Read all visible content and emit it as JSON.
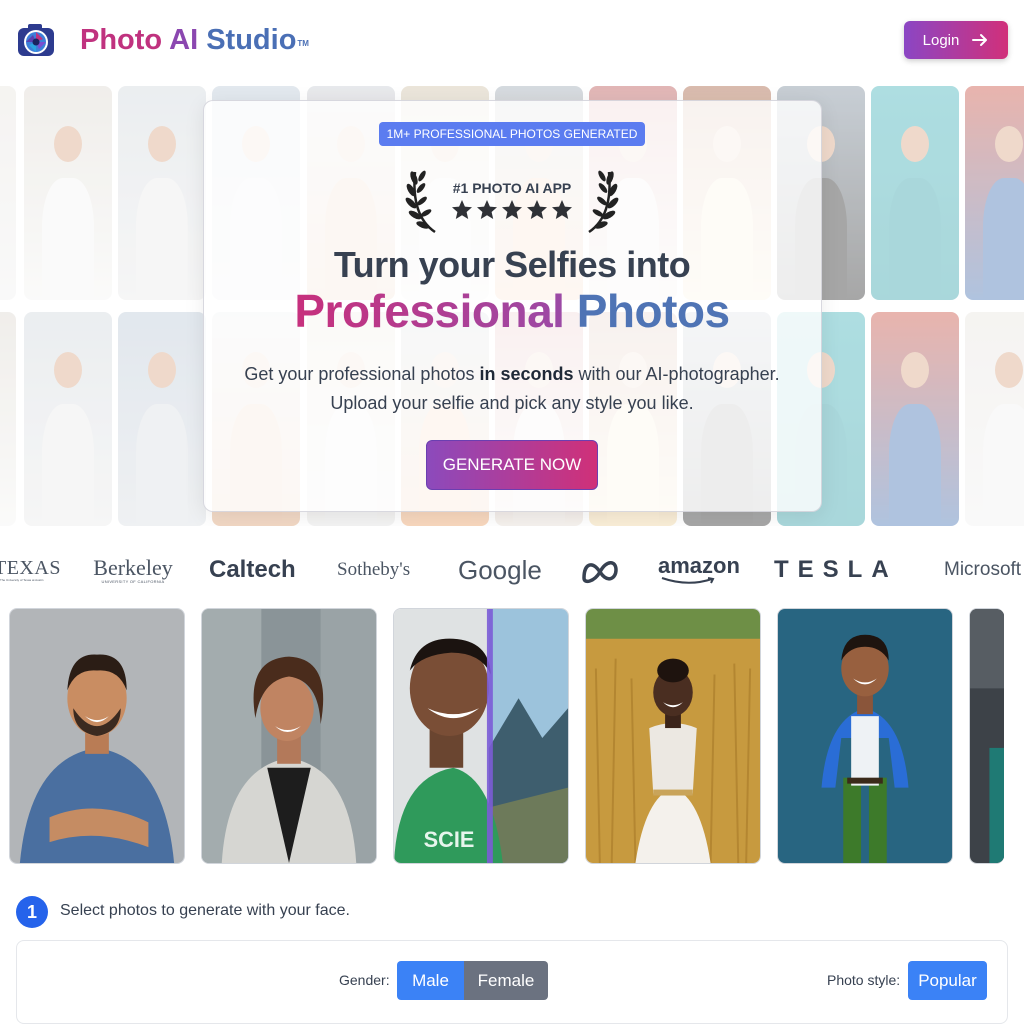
{
  "header": {
    "brand_word1": "Photo",
    "brand_word2": "AI",
    "brand_word3": "Studio",
    "brand_tm": "TM",
    "logo_icon": "camera-lens-icon",
    "login_label": "Login",
    "login_icon": "arrow-right-icon"
  },
  "hero": {
    "badge": "1M+ PROFESSIONAL PHOTOS GENERATED",
    "award": "#1 PHOTO AI APP",
    "rating_stars": 5,
    "headline_line1": "Turn your Selfies into",
    "headline_word1": "Professional",
    "headline_word2": "Photos",
    "sub_part1": "Get your professional photos ",
    "sub_bold": "in seconds",
    "sub_part2": " with our AI-photographer.",
    "sub_line2": "Upload your selfie and pick any style you like.",
    "cta": "GENERATE NOW"
  },
  "logos": [
    "TEXAS",
    "Berkeley",
    "Caltech",
    "Sotheby's",
    "Google",
    "meta-logo",
    "amazon",
    "TESLA",
    "Microsoft"
  ],
  "logo_subtext": {
    "texas": "The University of Texas at Austin",
    "berkeley": "UNIVERSITY OF CALIFORNIA"
  },
  "step": {
    "number": "1",
    "text": "Select photos to generate with your face."
  },
  "filters": {
    "gender_label": "Gender:",
    "male": "Male",
    "female": "Female",
    "style_label": "Photo style:",
    "style_value": "Popular"
  },
  "colors": {
    "brand_pink": "#c0327f",
    "brand_purple": "#8b47b0",
    "brand_blue": "#4a6fb5",
    "primary_blue": "#3b82f6",
    "step_blue": "#2563eb",
    "badge_blue": "#5b7cf0"
  }
}
